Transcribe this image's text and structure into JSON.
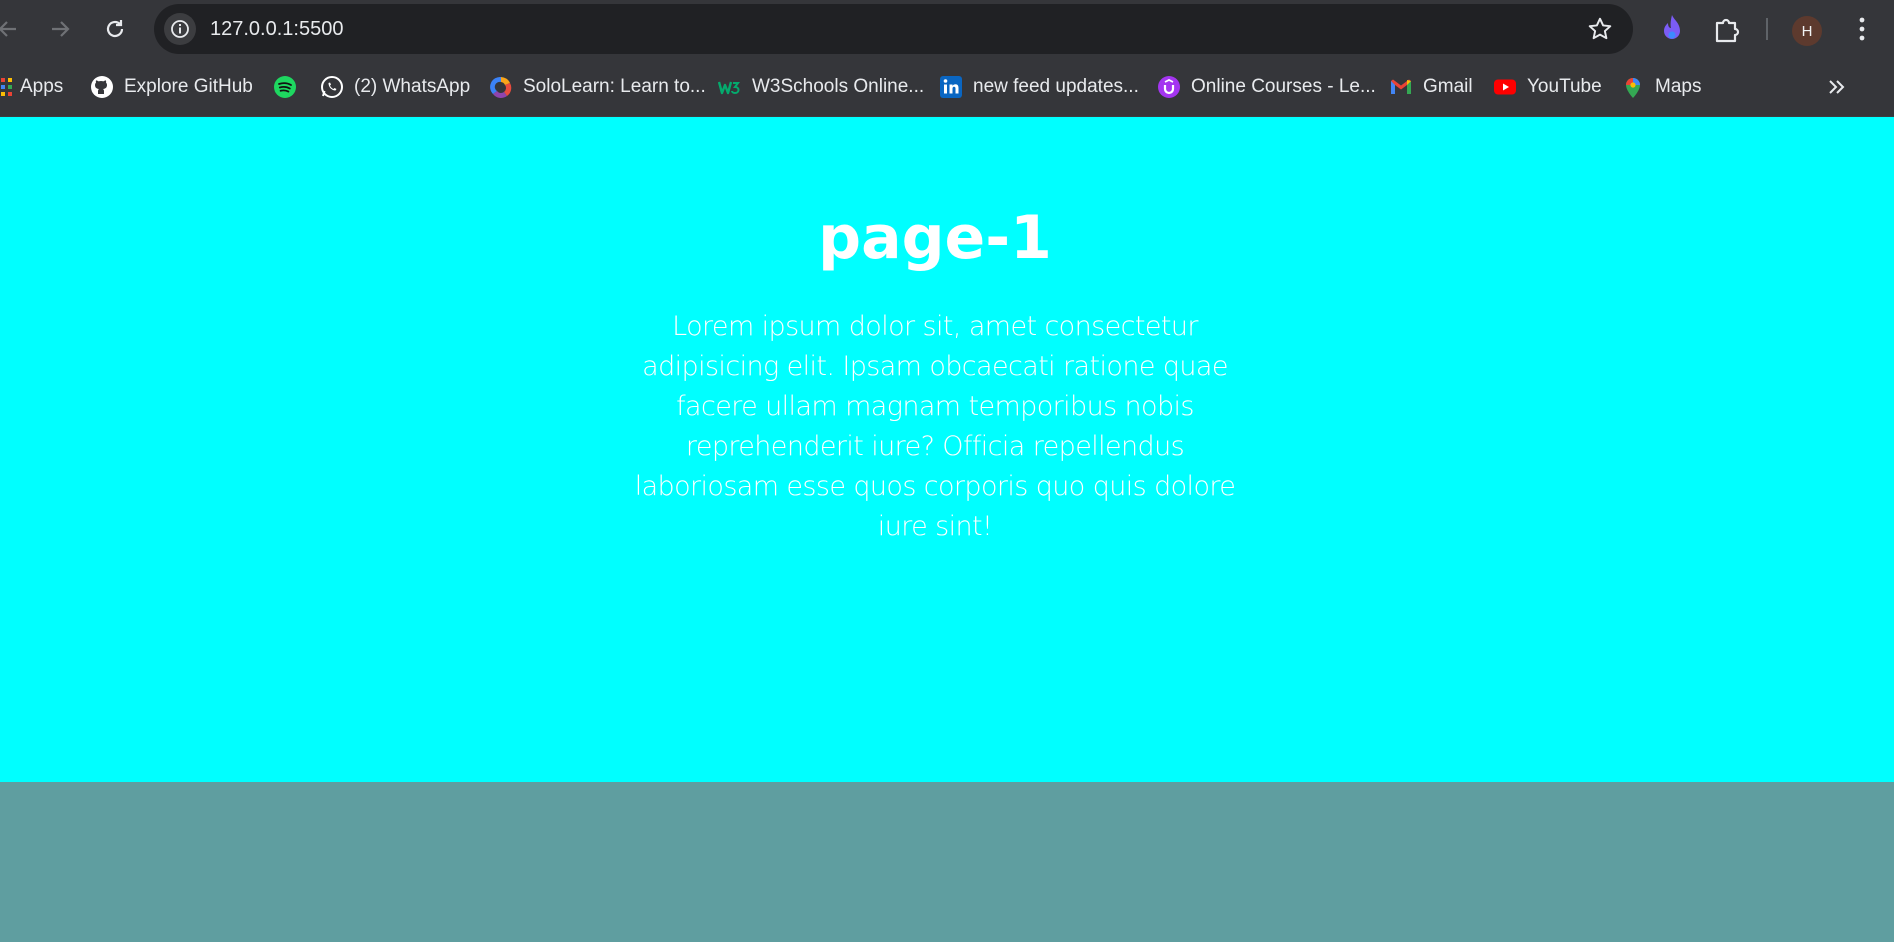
{
  "browser": {
    "url": "127.0.0.1:5500",
    "profile_initial": "H",
    "bookmarks": [
      {
        "label": "Apps",
        "icon": "apps-grid-icon"
      },
      {
        "label": "Explore GitHub",
        "icon": "github-icon"
      },
      {
        "label": "",
        "icon": "spotify-icon"
      },
      {
        "label": "(2) WhatsApp",
        "icon": "whatsapp-icon"
      },
      {
        "label": "SoloLearn: Learn to...",
        "icon": "sololearn-icon"
      },
      {
        "label": "W3Schools Online...",
        "icon": "w3schools-icon"
      },
      {
        "label": "new feed updates...",
        "icon": "linkedin-icon"
      },
      {
        "label": "Online Courses - Le...",
        "icon": "udemy-icon"
      },
      {
        "label": "Gmail",
        "icon": "gmail-icon"
      },
      {
        "label": "YouTube",
        "icon": "youtube-icon"
      },
      {
        "label": "Maps",
        "icon": "maps-icon"
      }
    ]
  },
  "page": {
    "title": "page-1",
    "paragraph": "Lorem ipsum dolor sit, amet consectetur adipisicing elit. Ipsam obcaecati ratione quae facere ullam magnam temporibus nobis reprehenderit iure? Officia repellendus laboriosam esse quos corporis quo quis dolore iure sint!"
  },
  "colors": {
    "section_one_bg": "#00ffff",
    "section_two_bg": "#5f9ea0",
    "browser_chrome": "#35363a"
  }
}
